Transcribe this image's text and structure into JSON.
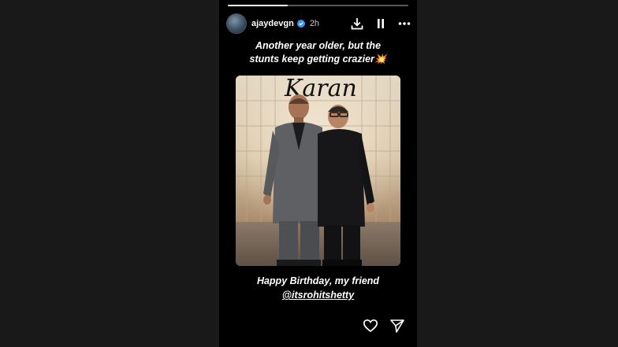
{
  "story": {
    "progress": 0.33,
    "header": {
      "username": "ajaydevgn",
      "timestamp": "2h",
      "verified": true,
      "icons": [
        "download-icon",
        "pause-icon",
        "more-options-icon"
      ]
    },
    "caption_top": {
      "line1": "Another year older, but the",
      "line2": "stunts keep getting crazier",
      "emoji": "💥"
    },
    "photo": {
      "backdrop_text": "Karan"
    },
    "caption_bottom": {
      "line1": "Happy Birthday, my friend",
      "mention": "@itsrohitshetty"
    },
    "footer": {
      "icons": [
        "heart-icon",
        "send-icon"
      ]
    }
  },
  "colors": {
    "background": "#1a1a1a",
    "story_background": "#000000",
    "text": "#ffffff",
    "verified_badge": "#3897f0"
  }
}
